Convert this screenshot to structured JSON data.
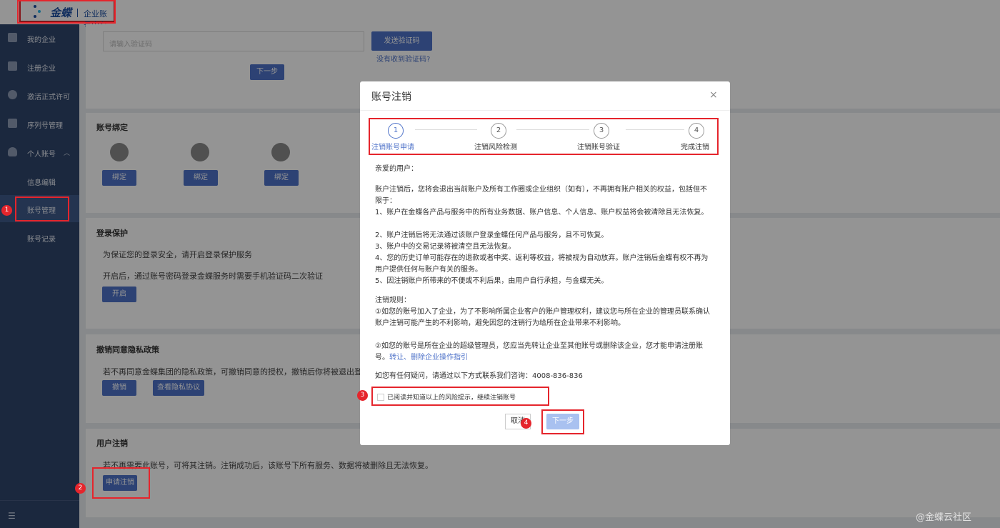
{
  "header": {
    "logo_text": "金蝶",
    "subtitle": "企业账号中心"
  },
  "sidebar": {
    "items": [
      {
        "label": "我的企业"
      },
      {
        "label": "注册企业"
      },
      {
        "label": "激活正式许可"
      },
      {
        "label": "序列号管理"
      },
      {
        "label": "个人账号"
      },
      {
        "label": "信息编辑"
      },
      {
        "label": "账号管理"
      },
      {
        "label": "账号记录"
      }
    ]
  },
  "verify": {
    "placeholder": "请输入验证码",
    "send_button": "发送验证码",
    "not_received_link": "没有收到验证码?",
    "next_button": "下一步"
  },
  "binding": {
    "title": "账号绑定",
    "bind_label": "绑定"
  },
  "login_protect": {
    "title": "登录保护",
    "line1": "为保证您的登录安全，请开启登录保护服务",
    "line2": "开启后，通过账号密码登录金蝶服务时需要手机验证码二次验证",
    "enable_button": "开启"
  },
  "privacy": {
    "title": "撤销同意隐私政策",
    "desc": "若不再同意金蝶集团的隐私政策，可撤销同意的授权，撤销后你将被退出登",
    "revoke_button": "撤销",
    "view_button": "查看隐私协议"
  },
  "cancel_account": {
    "title": "用户注销",
    "desc": "若不再需要此账号，可将其注销。注销成功后，该账号下所有服务、数据将被删除且无法恢复。",
    "apply_button": "申请注销"
  },
  "modal": {
    "title": "账号注销",
    "close_symbol": "×",
    "steps": [
      {
        "num": "1",
        "label": "注销账号申请"
      },
      {
        "num": "2",
        "label": "注销风险检测"
      },
      {
        "num": "3",
        "label": "注销账号验证"
      },
      {
        "num": "4",
        "label": "完成注销"
      }
    ],
    "greeting": "亲爱的用户：",
    "intro": "账户注销后，您将会退出当前账户及所有工作圈或企业组织（如有），不再拥有账户相关的权益，包括但不限于：",
    "points": [
      "1、账户在金蝶各产品与服务中的所有业务数据、账户信息、个人信息、账户权益将会被清除且无法恢复。",
      "2、账户注销后将无法通过该账户登录金蝶任何产品与服务，且不可恢复。",
      "3、账户中的交易记录将被清空且无法恢复。",
      "4、您的历史订单可能存在的退款或者中奖、返利等权益，将被视为自动放弃。账户注销后金蝶有权不再为用户提供任何与账户有关的服务。",
      "5、因注销账户所带来的不便或不利后果，由用户自行承担，与金蝶无关。"
    ],
    "rules_title": "注销规则：",
    "rule1": "①如您的账号加入了企业，为了不影响所属企业客户的账户管理权利，建议您与所在企业的管理员联系确认账户注销可能产生的不利影响，避免因您的注销行为给所在企业带来不利影响。",
    "rule2": "②如您的账号是所在企业的超级管理员，您应当先转让企业至其他账号或删除该企业，您才能申请注册账号。",
    "rule2_link": "转让、删除企业操作指引",
    "contact": "如您有任何疑问，请通过以下方式联系我们咨询：4008-836-836",
    "checkbox_label": "已阅读并知道以上的风险提示，继续注销账号",
    "cancel_button": "取消",
    "next_button": "下一步"
  },
  "annotations": {
    "badges": [
      "1",
      "2",
      "3",
      "4"
    ]
  },
  "watermark": "@金蝶云社区",
  "colors": {
    "accent": "#4f73c9",
    "sidebar": "#30456b",
    "annotation_red": "#e5252c"
  }
}
